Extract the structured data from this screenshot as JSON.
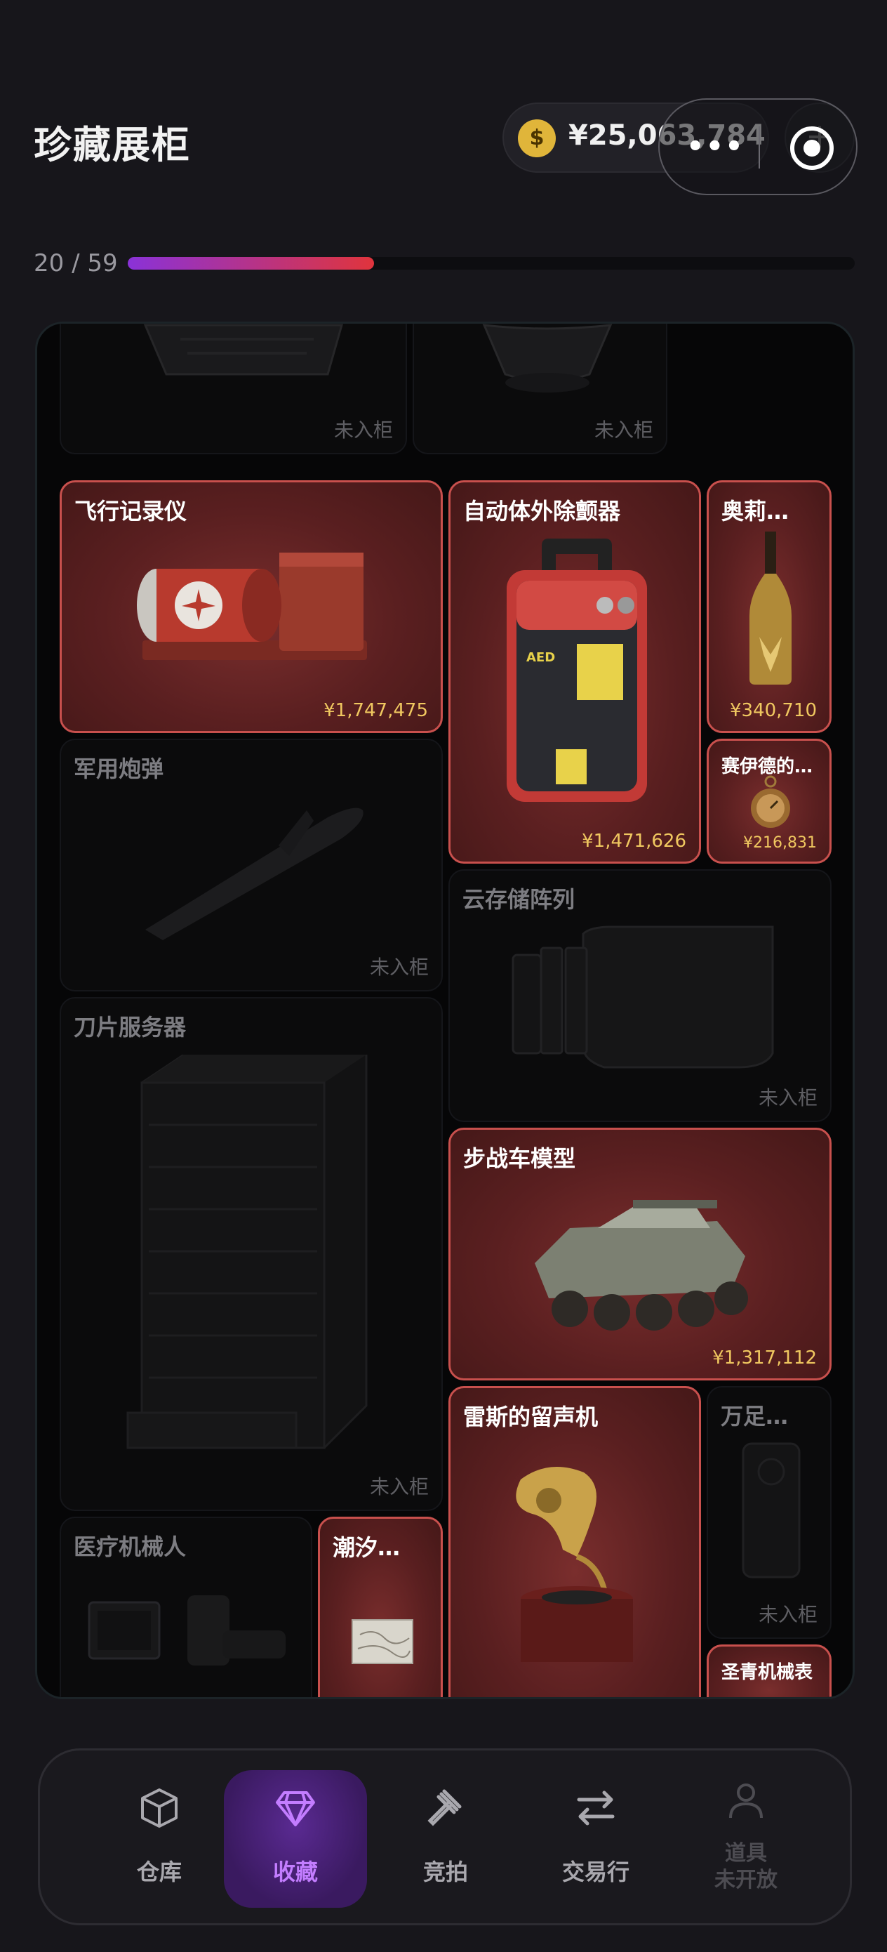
{
  "header": {
    "title": "珍藏展柜",
    "balance": "¥25,063,784",
    "coin_symbol": "$",
    "add_icon": "plus-icon"
  },
  "progress": {
    "label": "20 / 59",
    "collected": 20,
    "total": 59
  },
  "cabinet": {
    "cards": [
      {
        "name": "",
        "status": "未入柜",
        "owned": false
      },
      {
        "name": "",
        "status": "未入柜",
        "owned": false
      },
      {
        "name": "飞行记录仪",
        "price": "¥1,747,475",
        "owned": true
      },
      {
        "name": "自动体外除颤器",
        "price": "¥1,471,626",
        "owned": true
      },
      {
        "name": "奥莉…",
        "price": "¥340,710",
        "owned": true
      },
      {
        "name": "赛伊德的…",
        "price": "¥216,831",
        "owned": true
      },
      {
        "name": "军用炮弹",
        "status": "未入柜",
        "owned": false
      },
      {
        "name": "云存储阵列",
        "status": "未入柜",
        "owned": false
      },
      {
        "name": "刀片服务器",
        "status": "未入柜",
        "owned": false
      },
      {
        "name": "步战车模型",
        "price": "¥1,317,112",
        "owned": true
      },
      {
        "name": "雷斯的留声机",
        "owned": true
      },
      {
        "name": "万足…",
        "status": "未入柜",
        "owned": false
      },
      {
        "name": "医疗机械人",
        "owned": false
      },
      {
        "name": "潮汐…",
        "owned": true
      },
      {
        "name": "圣青机械表",
        "owned": true
      }
    ]
  },
  "nav": {
    "items": [
      {
        "label": "仓库",
        "icon": "box-icon"
      },
      {
        "label": "收藏",
        "icon": "diamond-icon",
        "active": true
      },
      {
        "label": "竞拍",
        "icon": "gavel-icon"
      },
      {
        "label": "交易行",
        "icon": "swap-icon"
      },
      {
        "label": "道具",
        "sub": "未开放",
        "icon": "person-icon"
      }
    ]
  },
  "colors": {
    "accent": "#c37dff",
    "progress_start": "#8a32d8",
    "progress_end": "#e0343c",
    "price": "#f0c860",
    "owned_border": "#c8504d"
  }
}
